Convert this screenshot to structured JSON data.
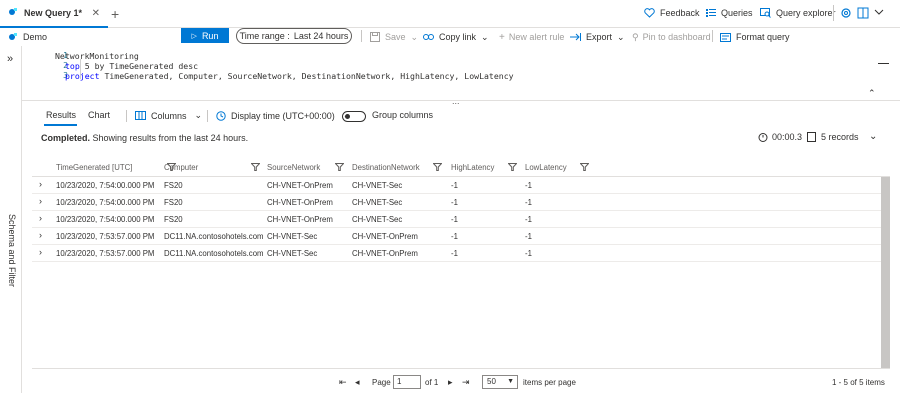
{
  "tabs": [
    {
      "label": "New Query 1*",
      "close": "✕"
    }
  ],
  "new_tab_glyph": "+",
  "top_links": {
    "feedback": "Feedback",
    "queries": "Queries",
    "query_explorer": "Query explorer"
  },
  "toolbar": {
    "scope": "Demo",
    "run": "Run",
    "time_range_label": "Time range :",
    "time_range_value": "Last 24 hours",
    "save": "Save",
    "copy_link": "Copy link",
    "new_alert_rule": "New alert rule",
    "export": "Export",
    "pin": "Pin to dashboard",
    "format": "Format query"
  },
  "editor": {
    "lines": [
      {
        "n": "1",
        "text": "NetworkMonitoring"
      },
      {
        "n": "2",
        "kw": "top",
        "rest": " 5 by TimeGenerated desc"
      },
      {
        "n": "3",
        "kw": "project",
        "rest": " TimeGenerated, Computer, SourceNetwork, DestinationNetwork, HighLatency, LowLatency"
      }
    ],
    "dots": "...",
    "collapse_glyph": "⌃"
  },
  "left_rail": {
    "label": "Schema and Filter",
    "expand_glyph": "»"
  },
  "results": {
    "tab_results": "Results",
    "tab_chart": "Chart",
    "columns": "Columns",
    "display_time": "Display time (UTC+00:00)",
    "group_columns": "Group columns",
    "status_bold": "Completed.",
    "status_text": " Showing results from the last 24 hours.",
    "elapsed": "00:00.3",
    "records": "5 records"
  },
  "grid": {
    "columns": [
      "TimeGenerated [UTC]",
      "Computer",
      "SourceNetwork",
      "DestinationNetwork",
      "HighLatency",
      "LowLatency"
    ],
    "rows": [
      [
        "10/23/2020, 7:54:00.000 PM",
        "FS20",
        "CH-VNET-OnPrem",
        "CH-VNET-Sec",
        "-1",
        "-1"
      ],
      [
        "10/23/2020, 7:54:00.000 PM",
        "FS20",
        "CH-VNET-OnPrem",
        "CH-VNET-Sec",
        "-1",
        "-1"
      ],
      [
        "10/23/2020, 7:54:00.000 PM",
        "FS20",
        "CH-VNET-OnPrem",
        "CH-VNET-Sec",
        "-1",
        "-1"
      ],
      [
        "10/23/2020, 7:53:57.000 PM",
        "DC11.NA.contosohotels.com",
        "CH-VNET-Sec",
        "CH-VNET-OnPrem",
        "-1",
        "-1"
      ],
      [
        "10/23/2020, 7:53:57.000 PM",
        "DC11.NA.contosohotels.com",
        "CH-VNET-Sec",
        "CH-VNET-OnPrem",
        "-1",
        "-1"
      ]
    ]
  },
  "pager": {
    "page_label": "Page",
    "page_value": "1",
    "of_label": "of 1",
    "page_size": "50",
    "items_per_page": "items per page",
    "range_text": "1 - 5 of 5 items"
  },
  "colors": {
    "accent": "#0078d4",
    "code_keyword": "#0000ff",
    "line_number": "#237893"
  }
}
